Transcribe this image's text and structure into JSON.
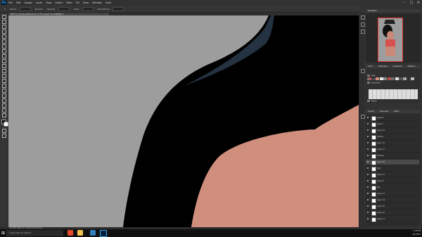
{
  "app": {
    "logo": "Ps"
  },
  "menu": [
    "File",
    "Edit",
    "Image",
    "Layer",
    "Type",
    "Select",
    "Filter",
    "3D",
    "View",
    "Window",
    "Help"
  ],
  "window_controls": {
    "minimize": "–",
    "maximize": "□",
    "close": "✕"
  },
  "options_bar": [
    "Mode:",
    "Normal",
    "Opacity:",
    "Flow:",
    "Smoothing:"
  ],
  "document_tab": "MM_FY_part_B_0009.psd @ 33.3% (Layer 16, RGB/8#) ×",
  "status_bar": "33.33%   3000 px x 4500 px (300 ppi)",
  "panels": {
    "navigator": {
      "tabs": [
        "Navigator"
      ]
    },
    "swatches": {
      "tabs": [
        "Color",
        "Swatches",
        "Gradients",
        "Patterns"
      ],
      "folders": [
        "RGB",
        "CMYK",
        "Grayscale",
        "Pastel"
      ]
    },
    "layers": {
      "tabs": [
        "Layers",
        "Channels",
        "Paths"
      ]
    }
  },
  "layers": [
    {
      "name": "Layer 8"
    },
    {
      "name": "Layer 7"
    },
    {
      "name": "Layer 19"
    },
    {
      "name": "Outline"
    },
    {
      "name": "Layer 18"
    },
    {
      "name": "Layer 17"
    },
    {
      "name": "Shadow"
    },
    {
      "name": "Layer 16",
      "selected": true
    },
    {
      "name": "Skin"
    },
    {
      "name": "Layer 12"
    },
    {
      "name": "Layer 9"
    },
    {
      "name": "Eye"
    },
    {
      "name": "Layer 13"
    },
    {
      "name": "Layer 14"
    },
    {
      "name": "Layer 15"
    },
    {
      "name": "Layer 10"
    },
    {
      "name": "Layer 11"
    }
  ],
  "taskbar": {
    "search_placeholder": "Type here to search",
    "time": "2:18 PM",
    "date": "4/1/2022"
  },
  "colors": {
    "canvas_bg": "#9d9d9d",
    "hair": "#000000",
    "highlight": "#243241",
    "skin": "#d08e7d"
  },
  "icons": [
    "windows-icon",
    "search-icon",
    "photoshop-icon"
  ]
}
